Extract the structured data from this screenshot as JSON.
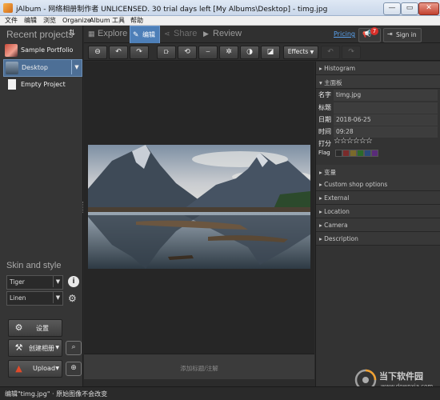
{
  "window": {
    "title": "jAlbum - 网络相册制作者 UNLICENSED. 30 trial days left [My Albums\\Desktop] - timg.jpg",
    "controls": [
      "—",
      "▭",
      "✕"
    ]
  },
  "menu": [
    "文件",
    "编辑",
    "浏览",
    "Organize",
    "Album",
    "工具",
    "帮助"
  ],
  "left": {
    "recent_title": "Recent projects",
    "sort_icon": "⇅",
    "projects": [
      {
        "label": "Sample Portfolio"
      },
      {
        "label": "Desktop"
      },
      {
        "label": "Empty Project"
      }
    ],
    "skin_title": "Skin and style",
    "skin_value": "Tiger",
    "style_value": "Linen",
    "settings_label": "设置",
    "make_label": "创建相册",
    "upload_label": "Upload"
  },
  "tabs": [
    {
      "label": "Explore",
      "icon": "▦"
    },
    {
      "label": "编辑",
      "icon": "✎"
    },
    {
      "label": "Share",
      "icon": "⋖"
    },
    {
      "label": "Review",
      "icon": "▶"
    }
  ],
  "header": {
    "pricing": "Pricing",
    "notifications": "7",
    "signin": "Sign in"
  },
  "toolbar": {
    "effects_label": "Effects",
    "buttons": [
      "⊖",
      "↶",
      "↷",
      "⟥",
      "⟲",
      "⌣",
      "✲",
      "◑",
      "◪"
    ],
    "undo": "↶",
    "redo": "↷"
  },
  "canvas": {
    "caption_placeholder": "添加标题/注解"
  },
  "right": {
    "histogram": "Histogram",
    "main_panel": "主面板",
    "fields": [
      {
        "label": "名字",
        "value": "timg.jpg"
      },
      {
        "label": "标题",
        "value": ""
      },
      {
        "label": "日期",
        "value": "2018-06-25"
      },
      {
        "label": "时间",
        "value": "09:28"
      }
    ],
    "rating_label": "打分",
    "stars": "☆☆☆☆☆☆",
    "flag_label": "Flag",
    "flag_colors": [
      "#2b2b2b",
      "#7a2b2b",
      "#7a6a2b",
      "#2b6a2b",
      "#2b4a7a",
      "#5a2b7a"
    ],
    "sections": [
      "变量",
      "Custom shop options",
      "External",
      "Location",
      "Camera",
      "Description"
    ]
  },
  "status": {
    "message": "编辑\"timg.jpg\" · 原始图像不会改变"
  },
  "watermark": {
    "text": "当下软件园",
    "url": "www.downxia.com"
  }
}
